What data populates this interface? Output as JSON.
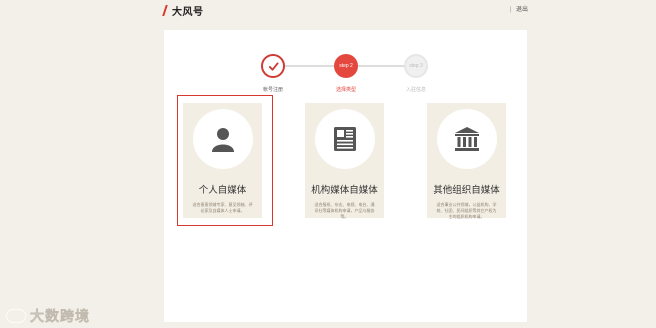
{
  "header": {
    "logo_text": "大风号",
    "right_sep": "|",
    "right_link": "退出"
  },
  "steps": [
    {
      "label": "帐号注册",
      "state": "done"
    },
    {
      "label": "选择类型",
      "circle_text": "step 2",
      "state": "active"
    },
    {
      "label": "入驻信息",
      "circle_text": "step 3",
      "state": "pending"
    }
  ],
  "cards": [
    {
      "title": "个人自媒体",
      "icon": "person-icon",
      "desc": "适合垂直领域专家、意见领袖、评论家及自媒体人士申请。",
      "selected": true
    },
    {
      "title": "机构媒体自媒体",
      "icon": "newspaper-icon",
      "desc": "适合报纸、杂志、电视、电台、通讯社等媒体机构申请，产品与服务等。",
      "selected": false
    },
    {
      "title": "其他组织自媒体",
      "icon": "institution-icon",
      "desc": "适合事业公共领域，公益机构、学校、社团、民间组织等其它产权为主的组织机构申请。",
      "selected": false
    }
  ],
  "watermark": "大数跨境",
  "colors": {
    "accent": "#e4473d",
    "card_bg": "#f3eee4",
    "page_bg": "#f3efe9"
  }
}
